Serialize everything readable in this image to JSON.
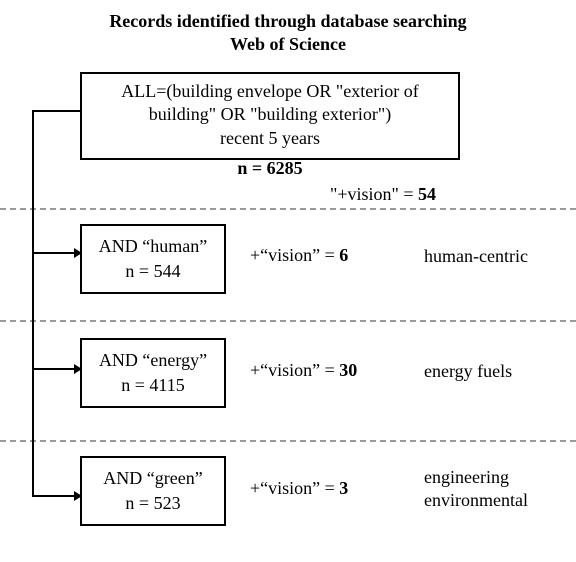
{
  "title_line1": "Records identified through database searching",
  "title_line2": "Web of Science",
  "root": {
    "query_line1": "ALL=(building envelope OR \"exterior of",
    "query_line2": "building\" OR \"building exterior\")",
    "timeframe": "recent 5 years",
    "n_label": "n = ",
    "n_value": "6285",
    "plus_vision_label": "\"+vision\" = ",
    "plus_vision_value": "54"
  },
  "branches": [
    {
      "term": "AND “human”",
      "n_text": "n = 544",
      "mid_label": "+“vision” = ",
      "mid_value": "6",
      "category": "human-centric"
    },
    {
      "term": "AND “energy”",
      "n_text": "n = 4115",
      "mid_label": "+“vision” = ",
      "mid_value": "30",
      "category": "energy fuels"
    },
    {
      "term": "AND “green”",
      "n_text": "n = 523",
      "mid_label": "+“vision” = ",
      "mid_value": "3",
      "category": "engineering\nenvironmental"
    }
  ],
  "chart_data": {
    "type": "table",
    "title": "Records identified through database searching — Web of Science",
    "base_query": "ALL=(building envelope OR \"exterior of building\" OR \"building exterior\") recent 5 years",
    "base_n": 6285,
    "base_plus_vision": 54,
    "rows": [
      {
        "refinement": "AND \"human\"",
        "n": 544,
        "plus_vision": 6,
        "category": "human-centric"
      },
      {
        "refinement": "AND \"energy\"",
        "n": 4115,
        "plus_vision": 30,
        "category": "energy fuels"
      },
      {
        "refinement": "AND \"green\"",
        "n": 523,
        "plus_vision": 3,
        "category": "engineering environmental"
      }
    ]
  }
}
